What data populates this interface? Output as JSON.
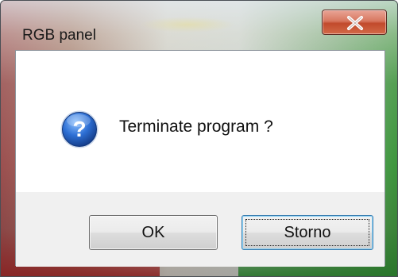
{
  "window": {
    "title": "RGB panel"
  },
  "message": {
    "text": "Terminate program ?",
    "icon": "question-icon"
  },
  "buttons": {
    "ok_label": "OK",
    "storno_label": "Storno",
    "close_icon": "close-icon"
  },
  "colors": {
    "close_button": "#c14a2c",
    "focus_border": "#3c7fb1",
    "button_area": "#f0f0f0",
    "icon_blue": "#1f4fa8"
  }
}
